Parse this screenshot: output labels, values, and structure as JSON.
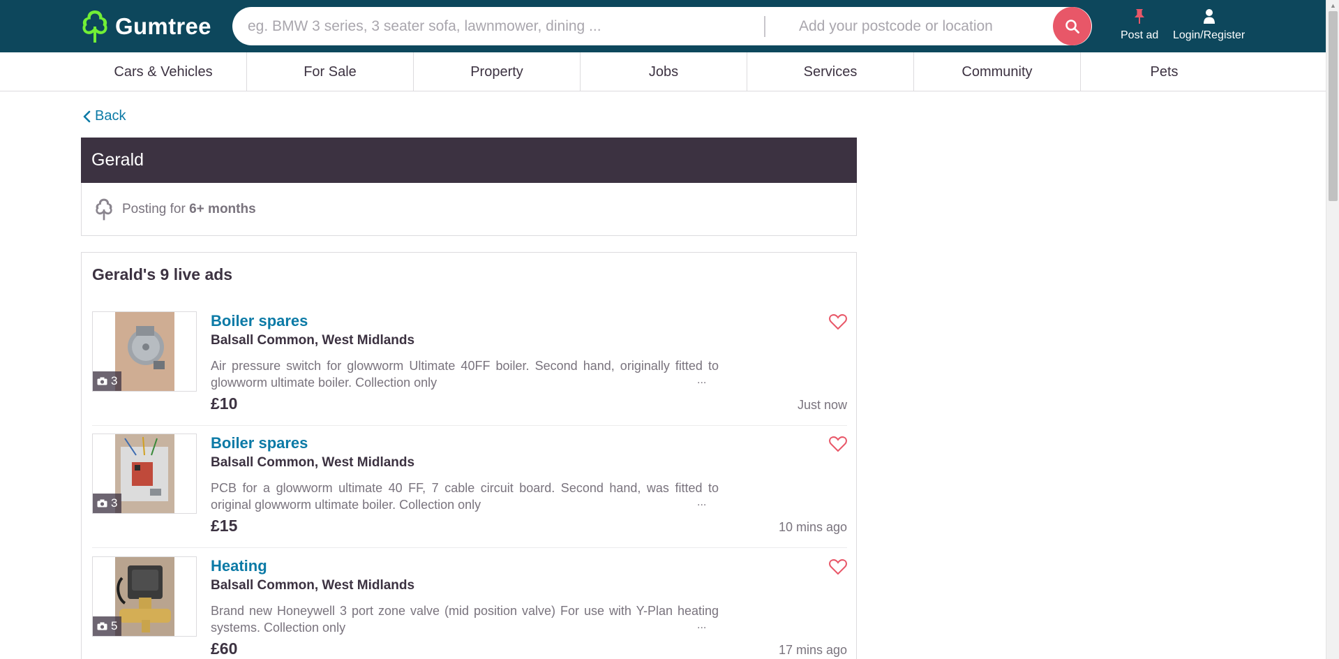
{
  "header": {
    "logo_text": "Gumtree",
    "search_placeholder": "eg. BMW 3 series, 3 seater sofa, lawnmower, dining ...",
    "location_placeholder": "Add your postcode or location",
    "post_ad_label": "Post ad",
    "login_label": "Login/Register",
    "brand_color": "#0d475c",
    "accent_color": "#e85768"
  },
  "categories": [
    {
      "label": "Cars & Vehicles"
    },
    {
      "label": "For Sale"
    },
    {
      "label": "Property"
    },
    {
      "label": "Jobs"
    },
    {
      "label": "Services"
    },
    {
      "label": "Community"
    },
    {
      "label": "Pets"
    }
  ],
  "back_label": "Back",
  "profile": {
    "name": "Gerald",
    "posting_for_prefix": "Posting for",
    "posting_for_value": "6+ months"
  },
  "ads_section": {
    "title": "Gerald's 9 live ads",
    "ads": [
      {
        "title": "Boiler spares",
        "location": "Balsall Common, West Midlands",
        "description": "Air pressure switch for glowworm Ultimate 40FF boiler. Second hand, originally fitted to glowworm ultimate boiler. Collection only",
        "price": "£10",
        "posted": "Just now",
        "photo_count": "3",
        "image_icon": "pressure-switch-photo"
      },
      {
        "title": "Boiler spares",
        "location": "Balsall Common, West Midlands",
        "description": "PCB for a glowworm ultimate 40 FF, 7 cable circuit board. Second hand, was fitted to original glowworm ultimate boiler. Collection only",
        "price": "£15",
        "posted": "10 mins ago",
        "photo_count": "3",
        "image_icon": "circuit-board-photo"
      },
      {
        "title": "Heating",
        "location": "Balsall Common, West Midlands",
        "description": "Brand new Honeywell 3 port zone valve (mid position valve) For use with Y-Plan heating systems. Collection only",
        "price": "£60",
        "posted": "17 mins ago",
        "photo_count": "5",
        "image_icon": "zone-valve-photo"
      }
    ],
    "ellipsis": "..."
  }
}
